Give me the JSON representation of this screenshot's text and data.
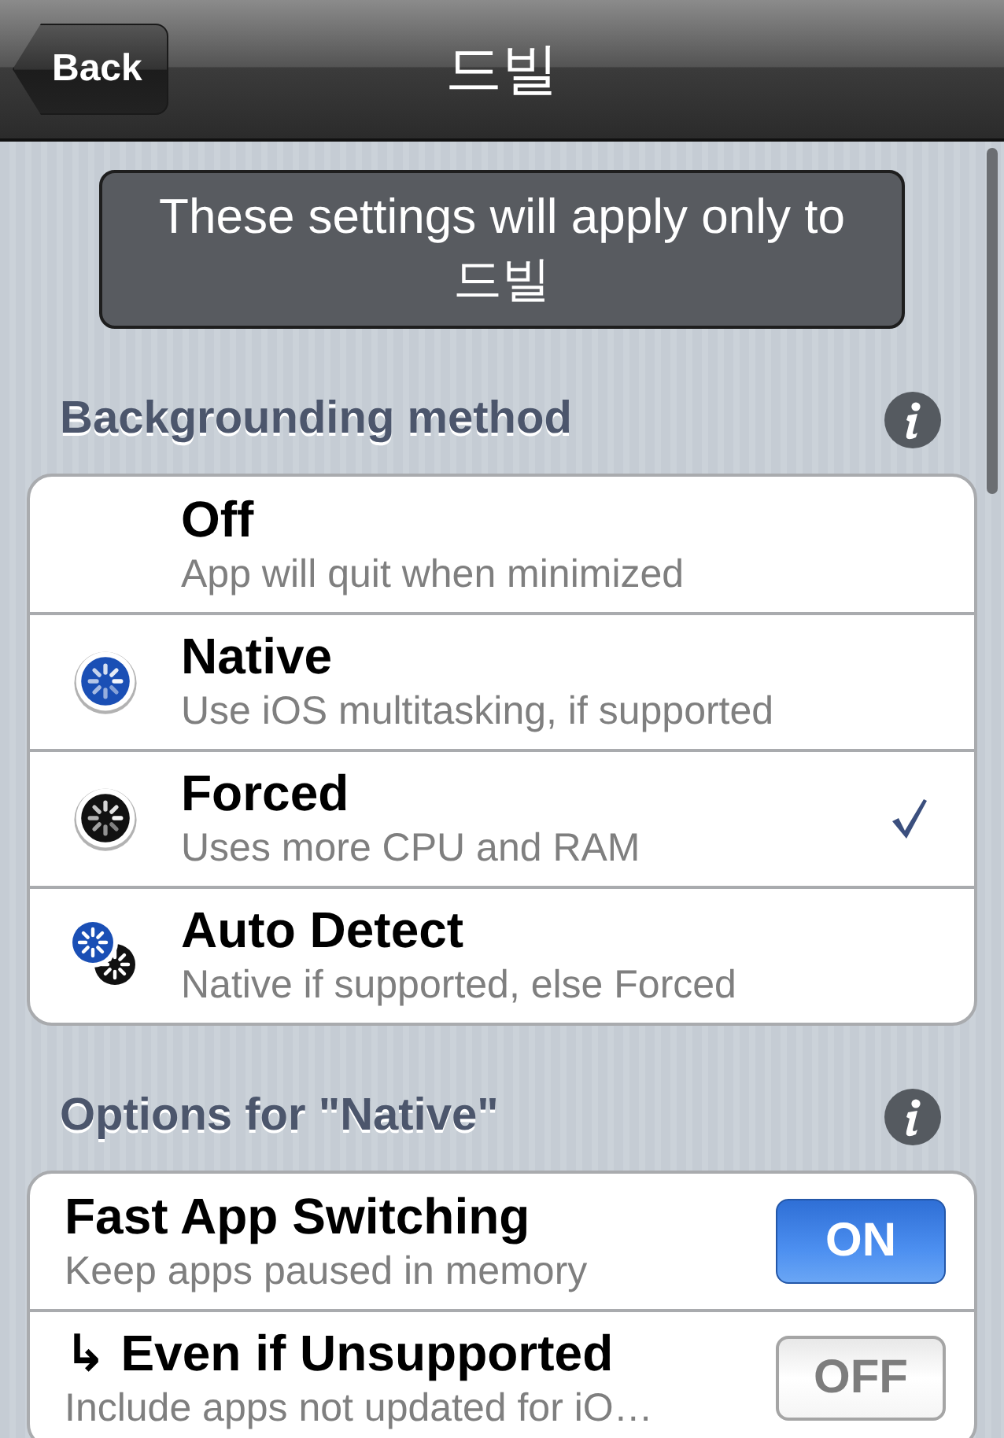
{
  "nav_bar": {
    "back_button": "Back",
    "title": "드빌"
  },
  "notice": "These settings will apply only to 드빌",
  "sections": [
    {
      "header": "Backgrounding method",
      "rows": [
        {
          "kind": "plain",
          "title": "Off",
          "subtitle": "App will quit when minimized",
          "selected": false
        },
        {
          "kind": "native",
          "title": "Native",
          "subtitle": "Use iOS multitasking, if supported",
          "selected": false
        },
        {
          "kind": "forced",
          "title": "Forced",
          "subtitle": "Uses more CPU and RAM",
          "selected": true
        },
        {
          "kind": "auto",
          "title": "Auto Detect",
          "subtitle": "Native if supported, else Forced",
          "selected": false
        }
      ]
    },
    {
      "header": "Options for \"Native\"",
      "rows": [
        {
          "kind": "switch",
          "title": "Fast App Switching",
          "subtitle": "Keep apps paused in memory",
          "on": true,
          "switch_label": "ON"
        },
        {
          "kind": "switch",
          "title": "↳ Even if Unsupported",
          "subtitle": "Include apps not updated for iO…",
          "on": false,
          "switch_label": "OFF"
        }
      ]
    }
  ]
}
